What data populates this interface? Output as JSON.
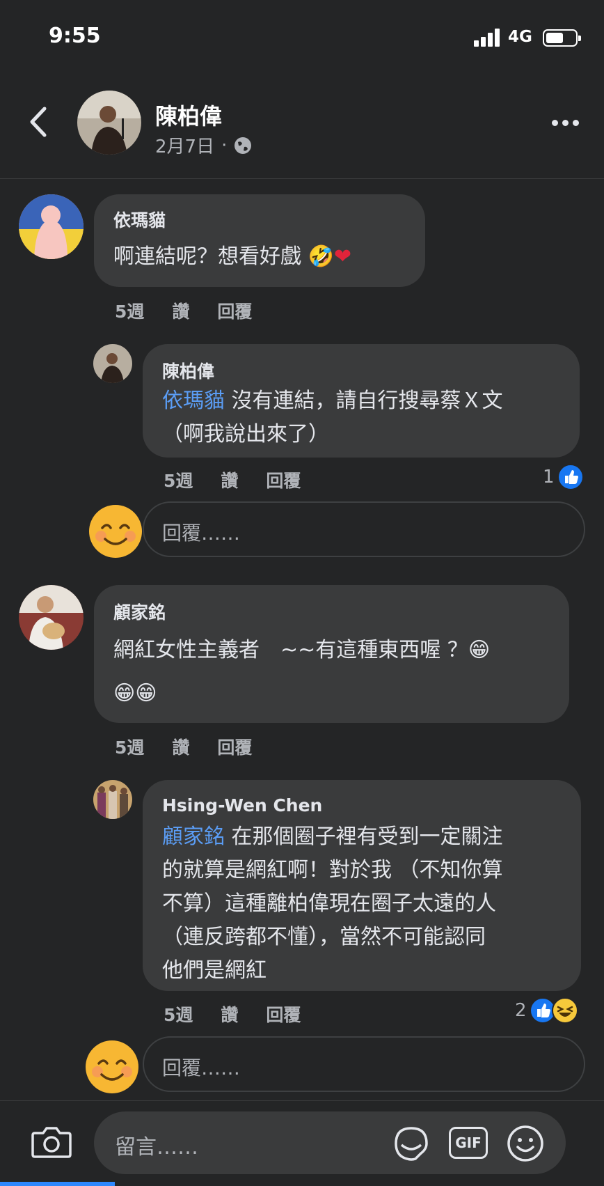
{
  "status_bar": {
    "time": "9:55",
    "network": "4G"
  },
  "post_header": {
    "name": "陳柏偉",
    "date": "2月7日",
    "separator": "·"
  },
  "comments": [
    {
      "author": "依瑪貓",
      "text": "啊連結呢？想看好戲",
      "time": "5週",
      "like": "讚",
      "reply": "回覆",
      "replies": [
        {
          "author": "陳柏偉",
          "mention": "依瑪貓",
          "line1": " 沒有連結，請自行搜尋蔡Ｘ文",
          "line2": "（啊我說出來了）",
          "time": "5週",
          "like": "讚",
          "reply": "回覆",
          "reaction_count": "1"
        }
      ],
      "reply_placeholder": "回覆……"
    },
    {
      "author": "顧家銘",
      "line1": "網紅女性主義者　~~有這種東西喔 ？",
      "time": "5週",
      "like": "讚",
      "reply": "回覆",
      "replies": [
        {
          "author": "Hsing-Wen Chen",
          "mention": "顧家銘",
          "line1": " 在那個圈子裡有受到一定關注",
          "line2": "的就算是網紅啊！對於我 （不知你算",
          "line3": "不算）這種離柏偉現在圈子太遠的人",
          "line4": "（連反跨都不懂），當然不可能認同",
          "line5": "他們是網紅",
          "time": "5週",
          "like": "讚",
          "reply": "回覆",
          "reaction_count": "2"
        }
      ],
      "reply_placeholder": "回覆……"
    }
  ],
  "composer": {
    "placeholder": "留言……",
    "gif_label": "GIF"
  },
  "icons": {
    "back": "chevron-left-icon",
    "more": "more-icon",
    "globe": "globe-icon",
    "like": "like-reaction-icon",
    "haha": "haha-reaction-icon",
    "camera": "camera-icon",
    "sticker": "sticker-icon",
    "emoji": "emoji-icon"
  },
  "colors": {
    "background": "#242526",
    "bubble": "#3a3b3c",
    "mention": "#5b9df5",
    "like_blue": "#1877f2"
  }
}
